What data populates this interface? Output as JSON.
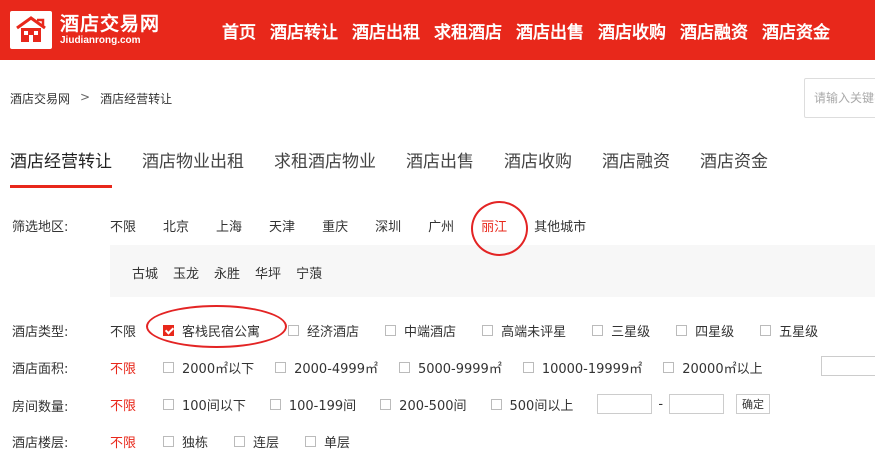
{
  "header": {
    "logo_cn": "酒店交易网",
    "logo_en": "Jiudianrong.com",
    "nav": [
      "首页",
      "酒店转让",
      "酒店出租",
      "求租酒店",
      "酒店出售",
      "酒店收购",
      "酒店融资",
      "酒店资金"
    ],
    "bg_color": "#e8281b"
  },
  "breadcrumb": {
    "home": "酒店交易网",
    "sep": ">",
    "current": "酒店经营转让"
  },
  "search": {
    "placeholder": "请输入关键字"
  },
  "tabs": [
    "酒店经营转让",
    "酒店物业出租",
    "求租酒店物业",
    "酒店出售",
    "酒店收购",
    "酒店融资",
    "酒店资金"
  ],
  "filters": {
    "region": {
      "label": "筛选地区:",
      "options": [
        "不限",
        "北京",
        "上海",
        "天津",
        "重庆",
        "深圳",
        "广州",
        "丽江",
        "其他城市"
      ],
      "selected": "丽江",
      "sub_options": [
        "古城",
        "玉龙",
        "永胜",
        "华坪",
        "宁蒗"
      ]
    },
    "type": {
      "label": "酒店类型:",
      "unlimited": "不限",
      "options": [
        "客栈民宿公寓",
        "经济酒店",
        "中端酒店",
        "高端未评星",
        "三星级",
        "四星级",
        "五星级"
      ],
      "checked": "客栈民宿公寓"
    },
    "area": {
      "label": "酒店面积:",
      "unlimited": "不限",
      "options": [
        "2000㎡以下",
        "2000-4999㎡",
        "5000-9999㎡",
        "10000-19999㎡",
        "20000㎡以上"
      ]
    },
    "rooms": {
      "label": "房间数量:",
      "unlimited": "不限",
      "options": [
        "100间以下",
        "100-199间",
        "200-500间",
        "500间以上"
      ],
      "range_dash": "-",
      "confirm": "确定"
    },
    "floors": {
      "label": "酒店楼层:",
      "unlimited": "不限",
      "options": [
        "独栋",
        "连层",
        "单层"
      ]
    }
  },
  "colors": {
    "accent": "#e8281b",
    "annotation": "#e32424"
  }
}
